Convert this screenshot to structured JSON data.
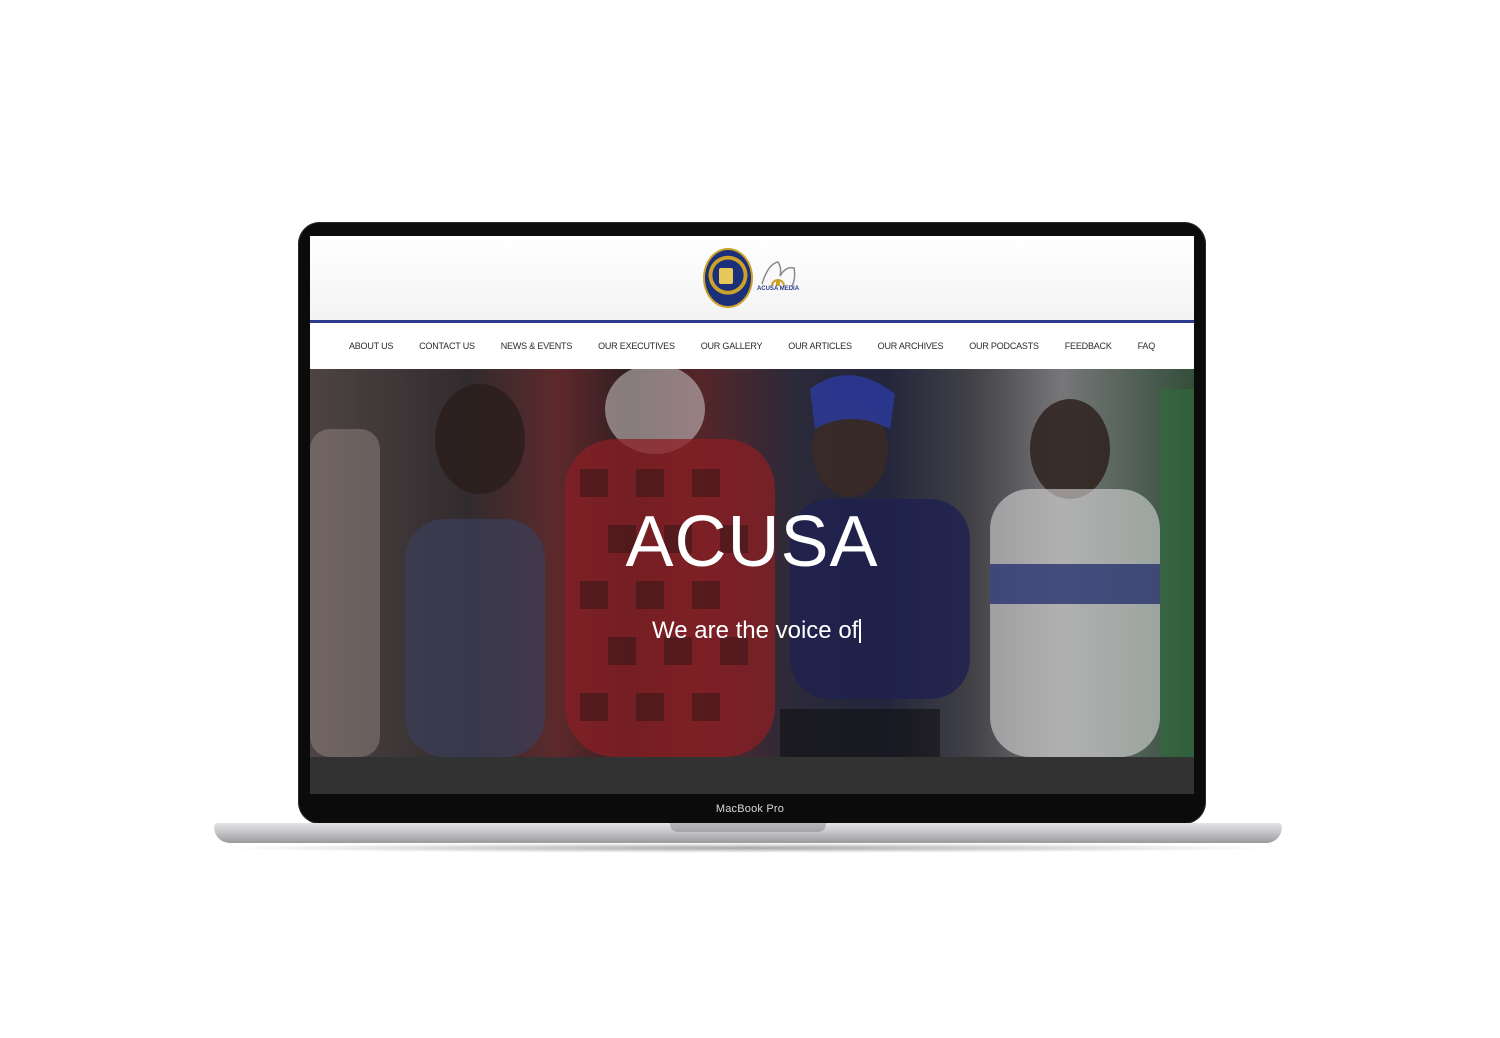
{
  "device": {
    "model_label": "MacBook Pro"
  },
  "header": {
    "seal_logo": "acusa-seal-logo",
    "media_logo_text": "ACUSA MEDIA"
  },
  "nav": {
    "items": [
      {
        "label": "ABOUT US"
      },
      {
        "label": "CONTACT US"
      },
      {
        "label": "NEWS & EVENTS"
      },
      {
        "label": "OUR EXECUTIVES"
      },
      {
        "label": "OUR GALLERY"
      },
      {
        "label": "OUR ARTICLES"
      },
      {
        "label": "OUR ARCHIVES"
      },
      {
        "label": "OUR PODCASTS"
      },
      {
        "label": "FEEDBACK"
      },
      {
        "label": "FAQ"
      }
    ]
  },
  "hero": {
    "title": "ACUSA",
    "subtitle": "We are the voice of"
  },
  "colors": {
    "brand_blue": "#2b3a8c",
    "gold": "#c9a227",
    "footer_dark": "#323232"
  }
}
